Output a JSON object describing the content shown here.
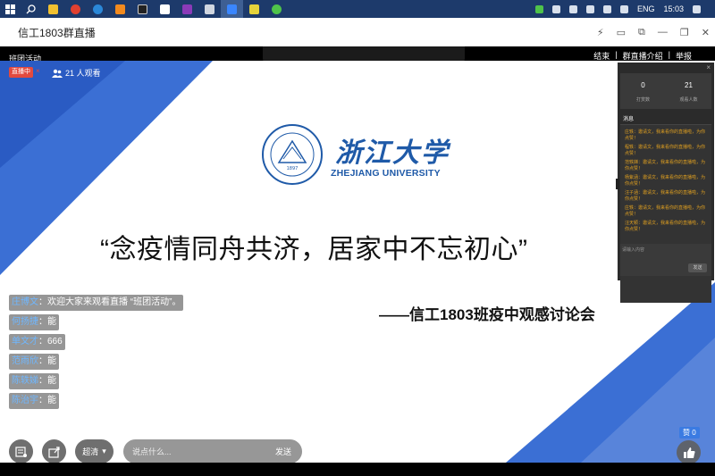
{
  "window": {
    "title": "信工1803群直播"
  },
  "header": {
    "room_title": "班团活动",
    "links": [
      "结束",
      "群直播介绍",
      "举报"
    ]
  },
  "live": {
    "status": "直播中",
    "close_glyph": "×",
    "viewer_count": "21 人观看"
  },
  "slide": {
    "university_cn": "浙江大学",
    "university_en": "ZHEJIANG UNIVERSITY",
    "slogan": "“念疫情同舟共济，居家中不忘初心”",
    "subtitle": "——信工1803班疫中观感讨论会"
  },
  "chat": [
    {
      "name": "庄博文",
      "text": "：欢迎大家来观看直播 “班团活动”。"
    },
    {
      "name": "何扬捷",
      "text": "：能"
    },
    {
      "name": "单文才",
      "text": "：666"
    },
    {
      "name": "范雨欣",
      "text": "：能"
    },
    {
      "name": "陈轶娣",
      "text": "：能"
    },
    {
      "name": "陈治宇",
      "text": "：能"
    }
  ],
  "controls": {
    "quality": "超清",
    "input_placeholder": "说点什么...",
    "send": "发送",
    "like_count": "赞 0"
  },
  "panel": {
    "close": "×",
    "stats": [
      {
        "value": "0",
        "label": "打赏数"
      },
      {
        "value": "21",
        "label": "观看人数"
      }
    ],
    "section": "消息",
    "messages": [
      "庄轶：邀请文，我来看你的直播啦，为你点赞！",
      "程轶：邀请文，我来看你的直播啦，为你点赞！",
      "范轶娣：邀请文，我来看你的直播啦，为你点赞！",
      "杨紫涵：邀请文，我来看你的直播啦，为你点赞！",
      "汪子涵：邀请文，我来看你的直播啦，为你点赞！",
      "庄轶：邀请文，我来看你的直播啦，为你点赞！",
      "汪天颖：邀请文，我来看你的直播啦，为你点赞！"
    ],
    "input_placeholder": "请输入内容",
    "send": "发送"
  },
  "system": {
    "language": "ENG",
    "time": "15:03"
  },
  "colors": {
    "slide_blue": "#3b6fd4",
    "logo_blue": "#1f5aa8",
    "live_red": "#e24a3f",
    "message_orange": "#e0a020"
  },
  "icons": [
    "windows-start-icon",
    "search-icon",
    "file-explorer-icon",
    "chrome-icon",
    "edge-icon",
    "sublime-icon",
    "terminal-icon",
    "photos-icon",
    "onenote-icon",
    "vm-icon",
    "dingtalk-icon",
    "notes-icon",
    "wechat-icon",
    "thumbs-up-icon",
    "user-icon",
    "pin-icon",
    "window-restore-icon",
    "minimize-icon",
    "maximize-icon",
    "close-icon"
  ]
}
